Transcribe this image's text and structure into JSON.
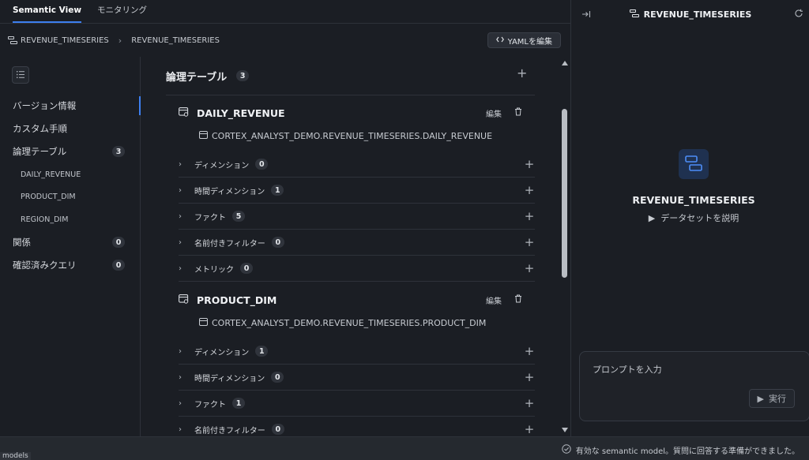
{
  "tabs": [
    {
      "label": "Semantic View",
      "active": true
    },
    {
      "label": "モニタリング",
      "active": false
    }
  ],
  "breadcrumb": [
    "REVENUE_TIMESERIES",
    "REVENUE_TIMESERIES"
  ],
  "toolbar": {
    "yaml_label": "YAMLを編集"
  },
  "sidebar": {
    "items": [
      {
        "label": "バージョン情報"
      },
      {
        "label": "カスタム手順"
      },
      {
        "label": "論理テーブル",
        "count": "3"
      },
      {
        "label": "DAILY_REVENUE"
      },
      {
        "label": "PRODUCT_DIM"
      },
      {
        "label": "REGION_DIM"
      },
      {
        "label": "関係",
        "count": "0"
      },
      {
        "label": "確認済みクエリ",
        "count": "0"
      }
    ]
  },
  "main": {
    "section_title": "論理テーブル",
    "section_count": "3",
    "edit_label": "編集",
    "tables": [
      {
        "name": "DAILY_REVENUE",
        "path": "CORTEX_ANALYST_DEMO.REVENUE_TIMESERIES.DAILY_REVENUE",
        "rows": [
          {
            "label": "ディメンション",
            "count": "0"
          },
          {
            "label": "時間ディメンション",
            "count": "1"
          },
          {
            "label": "ファクト",
            "count": "5"
          },
          {
            "label": "名前付きフィルター",
            "count": "0"
          },
          {
            "label": "メトリック",
            "count": "0"
          }
        ]
      },
      {
        "name": "PRODUCT_DIM",
        "path": "CORTEX_ANALYST_DEMO.REVENUE_TIMESERIES.PRODUCT_DIM",
        "rows": [
          {
            "label": "ディメンション",
            "count": "1"
          },
          {
            "label": "時間ディメンション",
            "count": "0"
          },
          {
            "label": "ファクト",
            "count": "1"
          },
          {
            "label": "名前付きフィルター",
            "count": "0"
          }
        ]
      }
    ]
  },
  "right_panel": {
    "title": "REVENUE_TIMESERIES",
    "model_name": "REVENUE_TIMESERIES",
    "explain_label": "データセットを説明",
    "prompt_placeholder": "プロンプトを入力",
    "run_label": "実行"
  },
  "status": {
    "left": "models",
    "right": "有効な semantic model。質問に回答する準備ができました。"
  },
  "colors": {
    "accent": "#3d7ff0",
    "background": "#1b1e24",
    "logo_bg": "#1f3150"
  }
}
